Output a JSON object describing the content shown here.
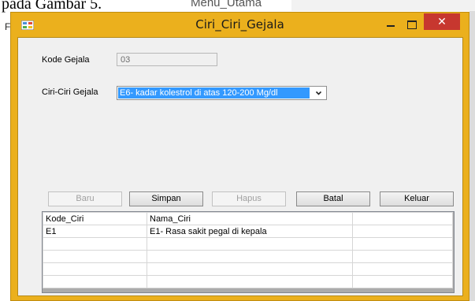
{
  "background": {
    "caption": "pada Gambar 5.",
    "menu_title": "Menu_Utama",
    "left_letter": "F"
  },
  "window": {
    "title": "Ciri_Ciri_Gejala",
    "close_glyph": "✕",
    "accent_color": "#ebb01d",
    "close_color": "#c7372f"
  },
  "form": {
    "kode_label": "Kode Gejala",
    "kode_value": "03",
    "ciri_label": "Ciri-Ciri Gejala",
    "ciri_selected": "E6- kadar kolestrol di atas 120-200 Mg/dl"
  },
  "buttons": {
    "baru": "Baru",
    "simpan": "Simpan",
    "hapus": "Hapus",
    "batal": "Batal",
    "keluar": "Keluar"
  },
  "grid": {
    "headers": [
      "Kode_Ciri",
      "Nama_Ciri"
    ],
    "rows": [
      [
        "E1",
        "E1- Rasa sakit pegal di kepala"
      ]
    ]
  },
  "icons": {
    "app": "app-icon",
    "dropdown": "chevron-down-icon",
    "minimize": "minimize-icon",
    "maximize": "maximize-icon",
    "close": "close-icon"
  }
}
